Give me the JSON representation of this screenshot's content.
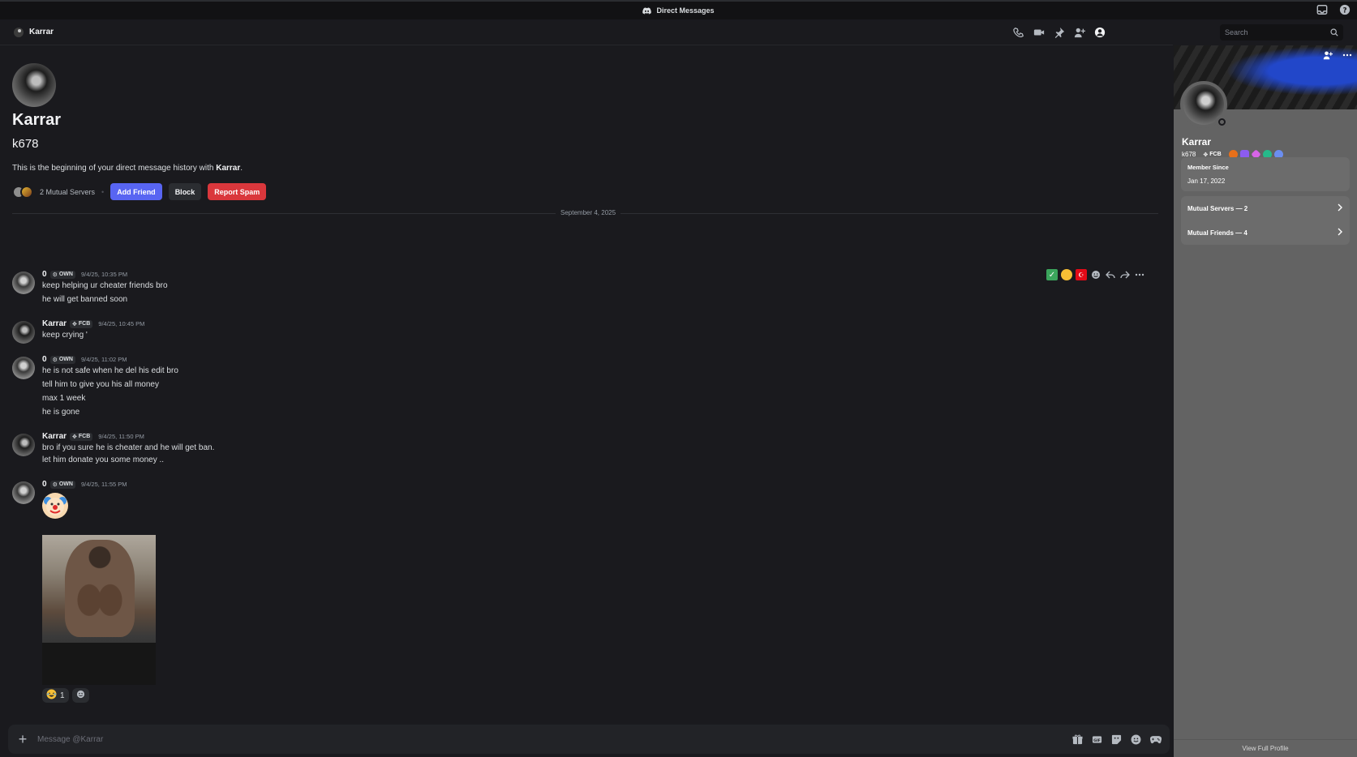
{
  "window": {
    "title": "Direct Messages"
  },
  "header": {
    "name": "Karrar",
    "search_placeholder": "Search"
  },
  "intro": {
    "display_name": "Karrar",
    "username": "k678",
    "text_prefix": "This is the beginning of your direct message history with ",
    "text_name": "Karrar",
    "text_suffix": ".",
    "mutual_servers": "2 Mutual Servers",
    "add_friend": "Add Friend",
    "block": "Block",
    "report_spam": "Report Spam"
  },
  "date_divider": "September 4, 2025",
  "messages": [
    {
      "author": "0",
      "tag": "OWN",
      "time": "9/4/25, 10:35 PM",
      "lines": [
        "keep helping ur cheater friends  bro",
        "he will get banned soon"
      ]
    },
    {
      "author": "Karrar",
      "tag": "FCB",
      "time": "9/4/25, 10:45 PM",
      "lines": [
        "keep crying '"
      ]
    },
    {
      "author": "0",
      "tag": "OWN",
      "time": "9/4/25, 11:02 PM",
      "lines": [
        "he is not safe when he del his edit bro",
        "tell him to give you his all money",
        "max 1 week",
        "he is gone"
      ]
    },
    {
      "author": "Karrar",
      "tag": "FCB",
      "time": "9/4/25, 11:50 PM",
      "lines": [
        "bro if you sure he is cheater and he will get ban.",
        "let him donate you some money .."
      ]
    },
    {
      "author": "0",
      "tag": "OWN",
      "time": "9/4/25, 11:55 PM",
      "lines": []
    }
  ],
  "reaction_count": "1",
  "composer": {
    "placeholder": "Message @Karrar"
  },
  "profile": {
    "display_name": "Karrar",
    "username": "k678",
    "tag": "FCB",
    "member_since_label": "Member Since",
    "member_since": "Jan 17, 2022",
    "mutual_servers": "Mutual Servers — 2",
    "mutual_friends": "Mutual Friends — 4",
    "view_full": "View Full Profile"
  },
  "colors": {
    "blurple": "#5865f2",
    "danger": "#da373c",
    "bg": "#1a1a1e",
    "panel": "#636363"
  }
}
